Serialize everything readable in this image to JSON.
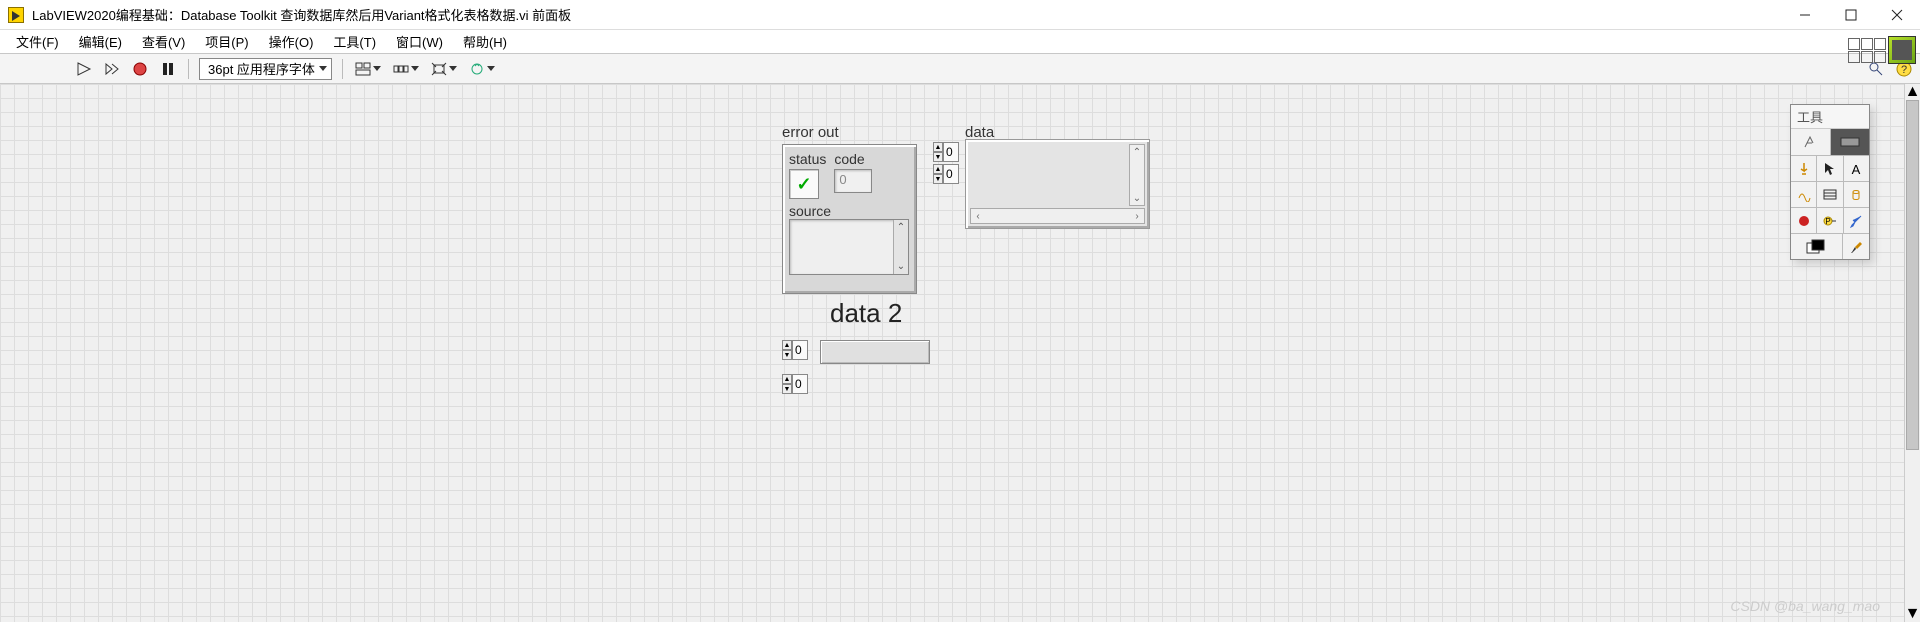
{
  "titlebar": {
    "title": "LabVIEW2020编程基础：Database Toolkit 查询数据库然后用Variant格式化表格数据.vi 前面板"
  },
  "menu": {
    "file": "文件(F)",
    "edit": "编辑(E)",
    "view": "查看(V)",
    "project": "项目(P)",
    "operate": "操作(O)",
    "tools": "工具(T)",
    "window": "窗口(W)",
    "help": "帮助(H)"
  },
  "toolbar": {
    "font": "36pt 应用程序字体"
  },
  "error_out": {
    "label": "error out",
    "status": "status",
    "code": "code",
    "code_val": "0",
    "source": "source"
  },
  "data": {
    "label": "data",
    "idx0": "0",
    "idx1": "0"
  },
  "data2": {
    "label": "data 2",
    "idx0": "0",
    "idx1": "0"
  },
  "tools_palette": {
    "title": "工具"
  },
  "watermark": "CSDN @ba_wang_mao"
}
